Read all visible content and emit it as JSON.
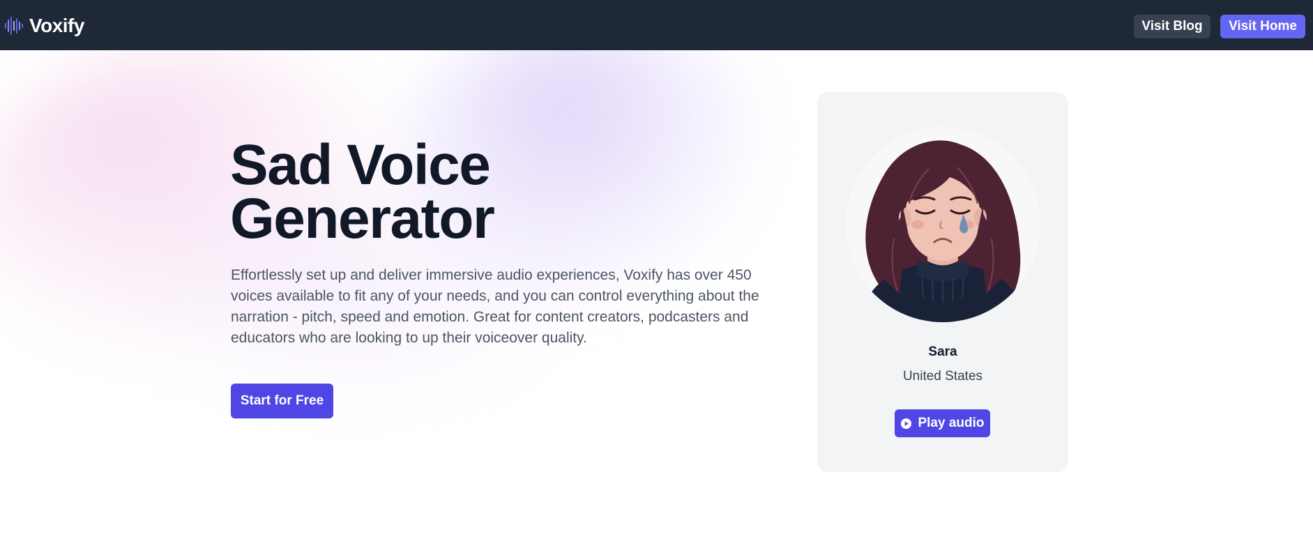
{
  "header": {
    "brand": "Voxify",
    "logo_icon": "soundwave-icon",
    "visit_blog": "Visit Blog",
    "visit_home": "Visit Home"
  },
  "hero": {
    "title_line1": "Sad Voice",
    "title_line2": "Generator",
    "description": "Effortlessly set up and deliver immersive audio experiences, Voxify has over 450 voices available to fit any of your needs, and you can control everything about the narration - pitch, speed and emotion. Great for content creators, podcasters and educators who are looking to up their voiceover quality.",
    "cta": "Start for Free"
  },
  "voice_card": {
    "name": "Sara",
    "country": "United States",
    "play_label": "Play audio",
    "play_icon": "play-circle-icon",
    "avatar_icon": "sad-woman-avatar"
  },
  "colors": {
    "header_bg": "#1e2837",
    "primary": "#4f46e5",
    "accent": "#6366f1",
    "secondary_btn": "#374151",
    "card_bg": "#f3f4f6",
    "title": "#111827",
    "body_text": "#4b5563"
  }
}
